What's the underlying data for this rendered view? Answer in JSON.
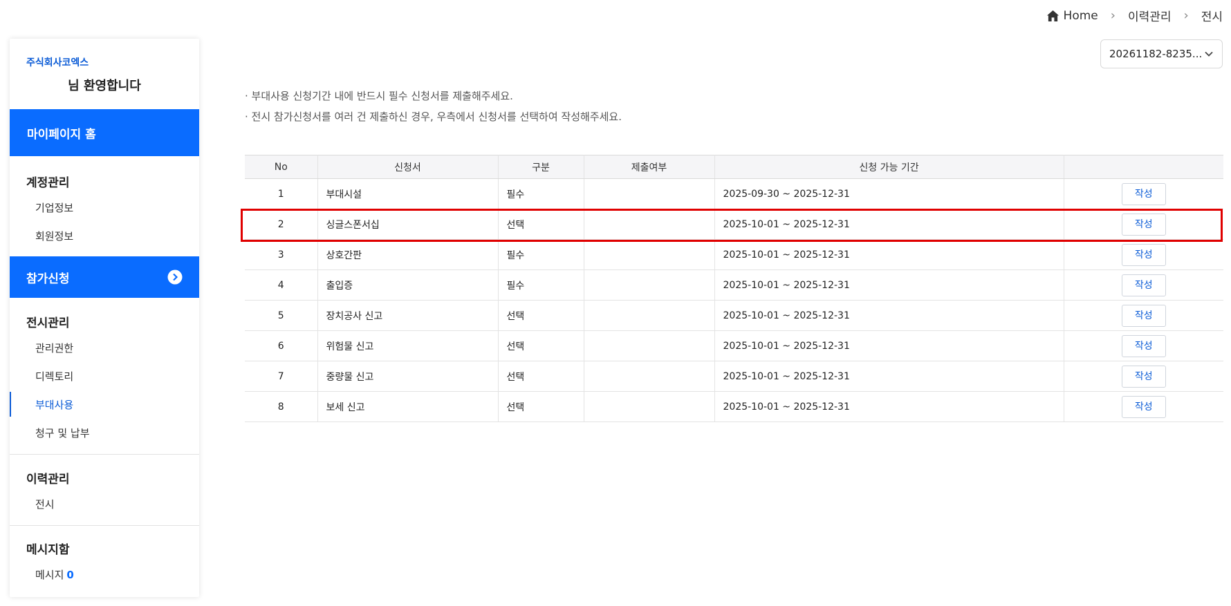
{
  "breadcrumb": {
    "home": "Home",
    "level1": "이력관리",
    "level2": "전시"
  },
  "selector": {
    "value": "20261182-8235..."
  },
  "sidebar": {
    "company": "주식회사코엑스",
    "welcome": "님 환영합니다",
    "home_label": "마이페이지 홈",
    "account": {
      "title": "계정관리",
      "items": [
        "기업정보",
        "회원정보"
      ]
    },
    "apply_label": "참가신청",
    "exhibition": {
      "title": "전시관리",
      "items": [
        "관리권한",
        "디렉토리",
        "부대사용",
        "청구 및 납부"
      ]
    },
    "history": {
      "title": "이력관리",
      "items": [
        "전시"
      ]
    },
    "message": {
      "title": "메시지함",
      "item": "메시지",
      "count": "0"
    }
  },
  "notices": [
    "· 부대사용 신청기간 내에 반드시 필수 신청서를 제출해주세요.",
    "· 전시 참가신청서를 여러 건 제출하신 경우, 우측에서 신청서를 선택하여 작성해주세요."
  ],
  "table": {
    "headers": [
      "No",
      "신청서",
      "구분",
      "제출여부",
      "신청 가능 기간",
      ""
    ],
    "action_label": "작성",
    "rows": [
      {
        "no": "1",
        "form": "부대시설",
        "type": "필수",
        "submitted": "",
        "period": "2025-09-30 ~ 2025-12-31"
      },
      {
        "no": "2",
        "form": "싱글스폰서십",
        "type": "선택",
        "submitted": "",
        "period": "2025-10-01 ~ 2025-12-31"
      },
      {
        "no": "3",
        "form": "상호간판",
        "type": "필수",
        "submitted": "",
        "period": "2025-10-01 ~ 2025-12-31"
      },
      {
        "no": "4",
        "form": "출입증",
        "type": "필수",
        "submitted": "",
        "period": "2025-10-01 ~ 2025-12-31"
      },
      {
        "no": "5",
        "form": "장치공사 신고",
        "type": "선택",
        "submitted": "",
        "period": "2025-10-01 ~ 2025-12-31"
      },
      {
        "no": "6",
        "form": "위험물 신고",
        "type": "선택",
        "submitted": "",
        "period": "2025-10-01 ~ 2025-12-31"
      },
      {
        "no": "7",
        "form": "중량물 신고",
        "type": "선택",
        "submitted": "",
        "period": "2025-10-01 ~ 2025-12-31"
      },
      {
        "no": "8",
        "form": "보세 신고",
        "type": "선택",
        "submitted": "",
        "period": "2025-10-01 ~ 2025-12-31"
      }
    ]
  },
  "colors": {
    "primary": "#0a6cff",
    "link": "#0a5bd6",
    "highlight": "#e00000"
  },
  "icons": [
    "home-icon",
    "chevron-right-icon",
    "chevron-down-icon",
    "arrow-right-circle-icon"
  ]
}
